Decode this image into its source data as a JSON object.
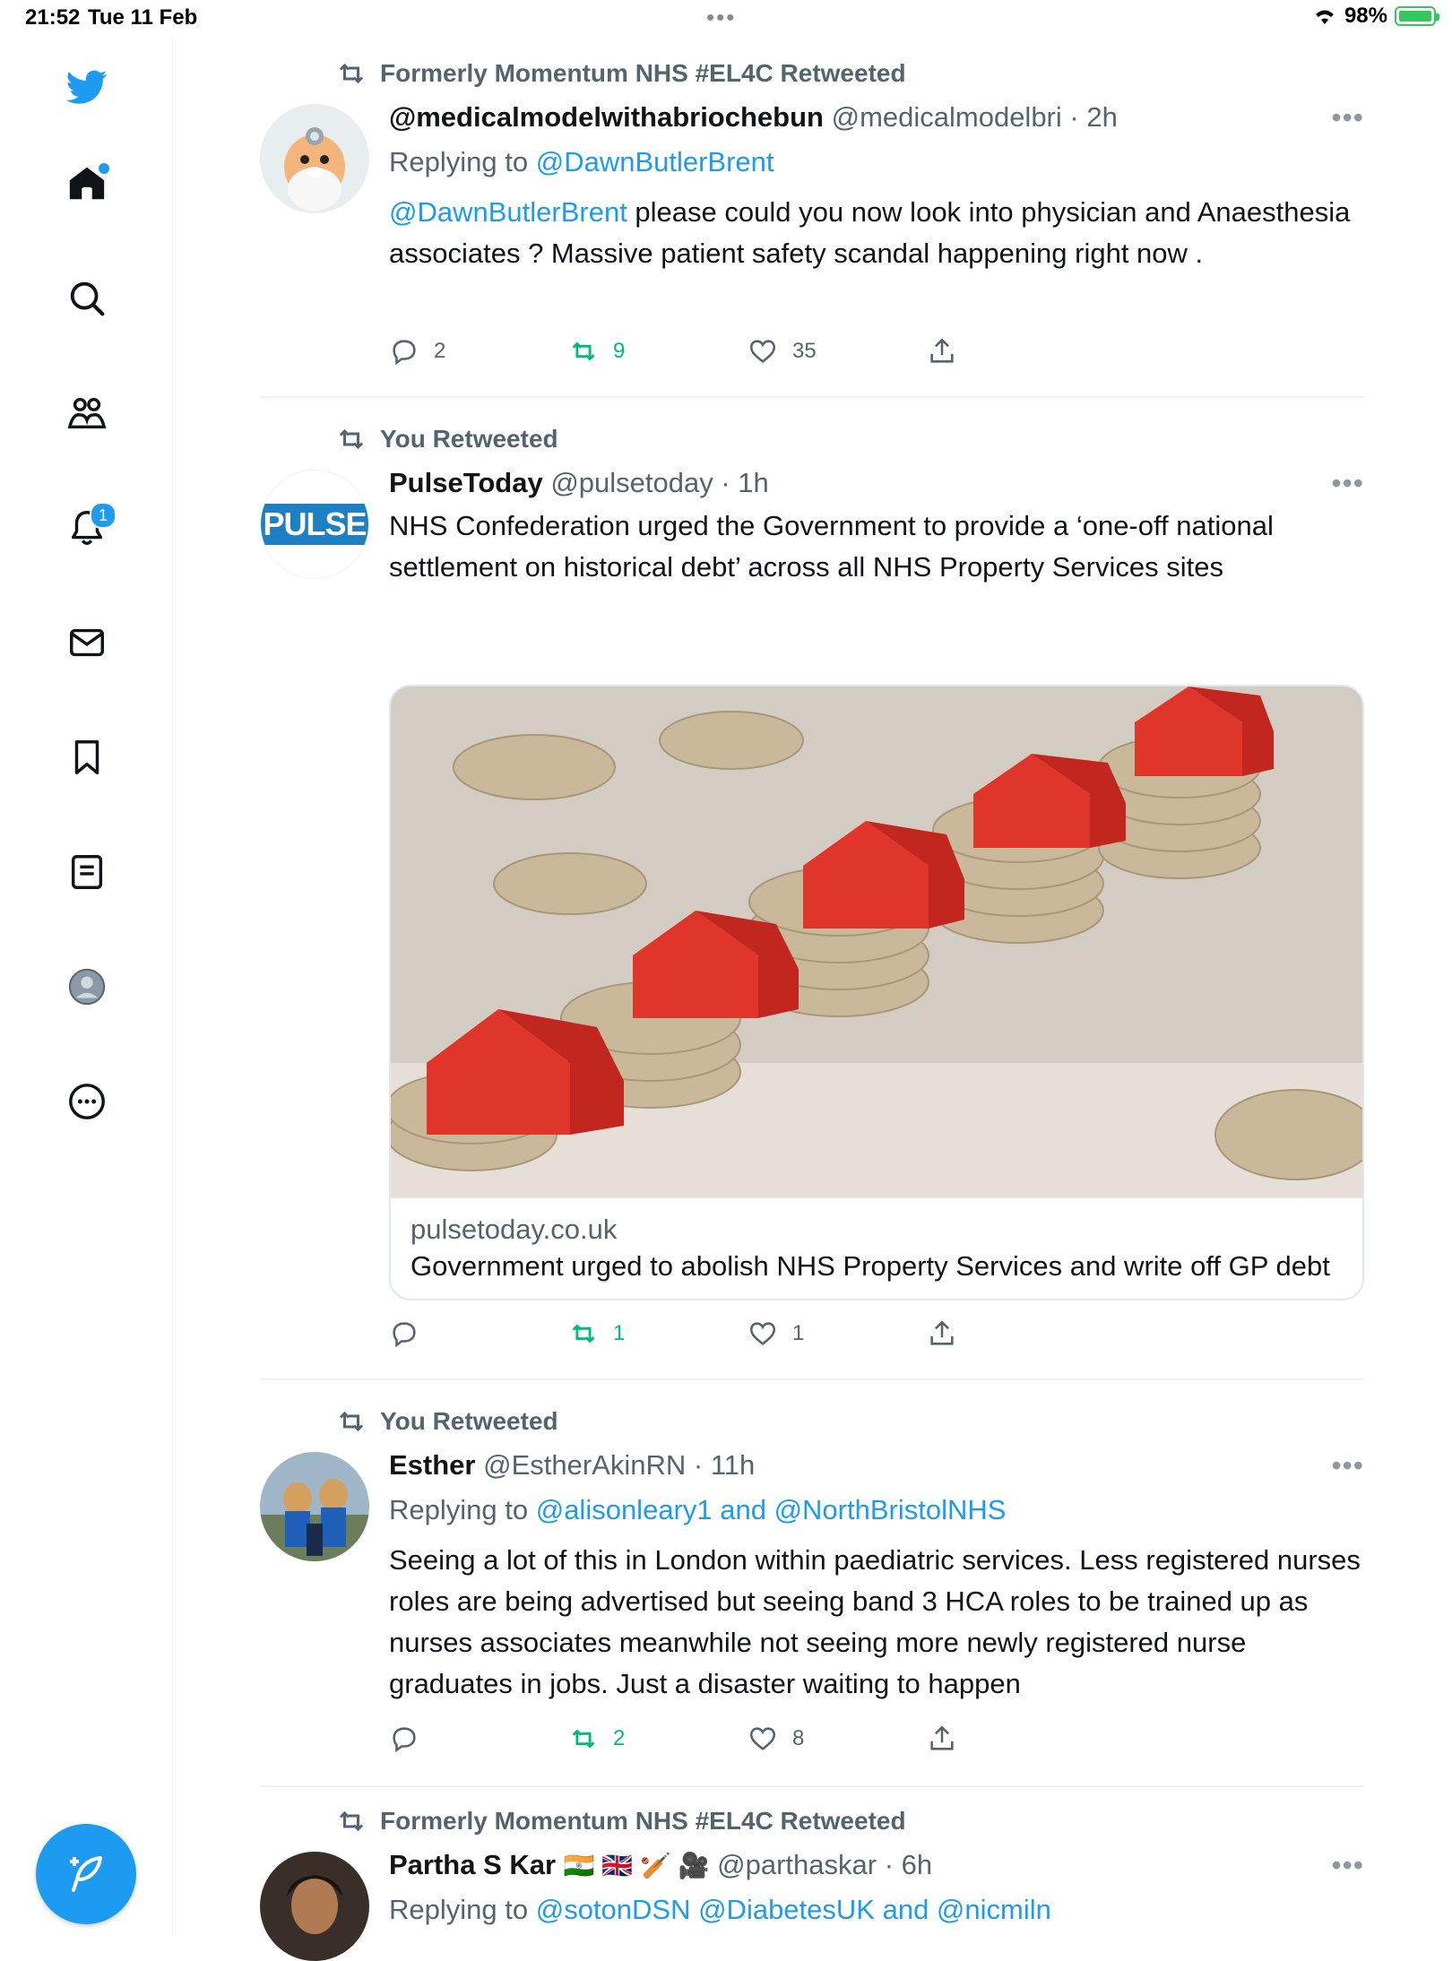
{
  "status_bar": {
    "time": "21:52",
    "date": "Tue 11 Feb",
    "battery": "98%"
  },
  "sidebar": {
    "items": [
      {
        "name": "home",
        "badge": ""
      },
      {
        "name": "explore",
        "badge": ""
      },
      {
        "name": "communities",
        "badge": ""
      },
      {
        "name": "notifications",
        "badge": "1"
      },
      {
        "name": "messages",
        "badge": ""
      },
      {
        "name": "bookmarks",
        "badge": ""
      },
      {
        "name": "lists",
        "badge": ""
      },
      {
        "name": "profile",
        "badge": ""
      },
      {
        "name": "more",
        "badge": ""
      }
    ]
  },
  "tweets": [
    {
      "retweeted_by": "Formerly Momentum NHS #EL4C Retweeted",
      "name": "@medicalmodelwithabriochebun",
      "handle": "@medicalmodelbri",
      "time": "· 2h",
      "replying_prefix": "Replying to ",
      "replying_to": "@DawnButlerBrent",
      "mention": "@DawnButlerBrent",
      "text": " please could you now look into physician and Anaesthesia associates ? Massive patient safety scandal happening right now .",
      "replies": "2",
      "retweets": "9",
      "likes": "35"
    },
    {
      "retweeted_by": "You Retweeted",
      "name": "PulseToday",
      "handle": "@pulsetoday",
      "time": "· 1h",
      "avatar_text": "PULSE",
      "text": "NHS Confederation urged the Government to provide a ‘one-off national settlement on historical debt’ across all NHS Property Services sites",
      "card_domain": "pulsetoday.co.uk",
      "card_title": "Government urged to abolish NHS Property Services and write off GP debt",
      "replies": "",
      "retweets": "1",
      "likes": "1"
    },
    {
      "retweeted_by": "You Retweeted",
      "name": "Esther",
      "handle": "@EstherAkinRN",
      "time": "· 11h",
      "replying_prefix": "Replying to ",
      "replying_to": "@alisonleary1 and @NorthBristolNHS",
      "text": "Seeing a lot of this in London within paediatric services. Less registered nurses roles are being advertised but seeing band 3 HCA roles to be trained up as nurses associates meanwhile not seeing more newly registered nurse graduates in jobs. Just a disaster waiting to happen",
      "replies": "",
      "retweets": "2",
      "likes": "8"
    },
    {
      "retweeted_by": "Formerly Momentum NHS #EL4C Retweeted",
      "name": "Partha S Kar",
      "name_emoji": "🇮🇳 🇬🇧 🏏 🎥",
      "handle": "@parthaskar",
      "time": "· 6h",
      "replying_prefix": "Replying to ",
      "replying_to": "@sotonDSN @DiabetesUK and @nicmiln"
    }
  ],
  "colors": {
    "accent": "#1d9bf0",
    "retweet_green": "#00ba7c",
    "muted": "#536471"
  }
}
